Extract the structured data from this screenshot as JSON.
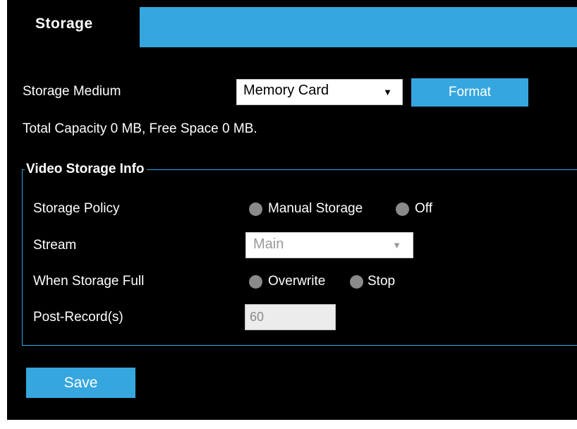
{
  "tabs": {
    "active_label": "Storage"
  },
  "storage_medium": {
    "label": "Storage Medium",
    "selected": "Memory Card",
    "format_button": "Format"
  },
  "capacity_text": "Total Capacity  0  MB, Free Space  0  MB.",
  "video_storage": {
    "legend": "Video Storage Info",
    "policy": {
      "label": "Storage Policy",
      "options": [
        "Manual Storage",
        "Off"
      ]
    },
    "stream": {
      "label": "Stream",
      "selected": "Main"
    },
    "when_full": {
      "label": "When Storage Full",
      "options": [
        "Overwrite",
        "Stop"
      ]
    },
    "post_record": {
      "label": "Post-Record(s)",
      "value": "60"
    }
  },
  "save_button": "Save",
  "colors": {
    "accent": "#36a6de",
    "background": "#000000",
    "radio_disabled": "#8a8a8a"
  },
  "icons": {
    "dropdown": "triangle-down-icon"
  }
}
